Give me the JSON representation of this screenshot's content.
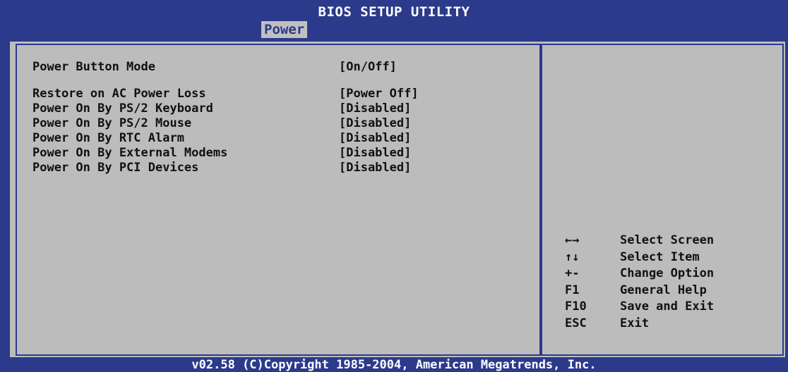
{
  "header": {
    "title": "BIOS SETUP UTILITY",
    "active_tab": "Power"
  },
  "settings": [
    {
      "label": "Power Button Mode",
      "value": "[On/Off]"
    },
    {
      "label": "Restore on AC Power Loss",
      "value": "[Power Off]"
    },
    {
      "label": "Power On By PS/2 Keyboard",
      "value": "[Disabled]"
    },
    {
      "label": "Power On By PS/2 Mouse",
      "value": "[Disabled]"
    },
    {
      "label": "Power On By RTC Alarm",
      "value": "[Disabled]"
    },
    {
      "label": "Power On By External Modems",
      "value": "[Disabled]"
    },
    {
      "label": "Power On By PCI Devices",
      "value": "[Disabled]"
    }
  ],
  "help": [
    {
      "key": "←→",
      "desc": "Select Screen"
    },
    {
      "key": "↑↓",
      "desc": "Select Item"
    },
    {
      "key": "+-",
      "desc": "Change Option"
    },
    {
      "key": "F1",
      "desc": "General Help"
    },
    {
      "key": "F10",
      "desc": "Save and Exit"
    },
    {
      "key": "ESC",
      "desc": "Exit"
    }
  ],
  "footer": {
    "text": "v02.58 (C)Copyright 1985-2004, American Megatrends, Inc."
  },
  "colors": {
    "frame_blue": "#2b3a8a",
    "panel_gray": "#bcbcbc",
    "text": "#111111",
    "header_text": "#ffffff"
  }
}
